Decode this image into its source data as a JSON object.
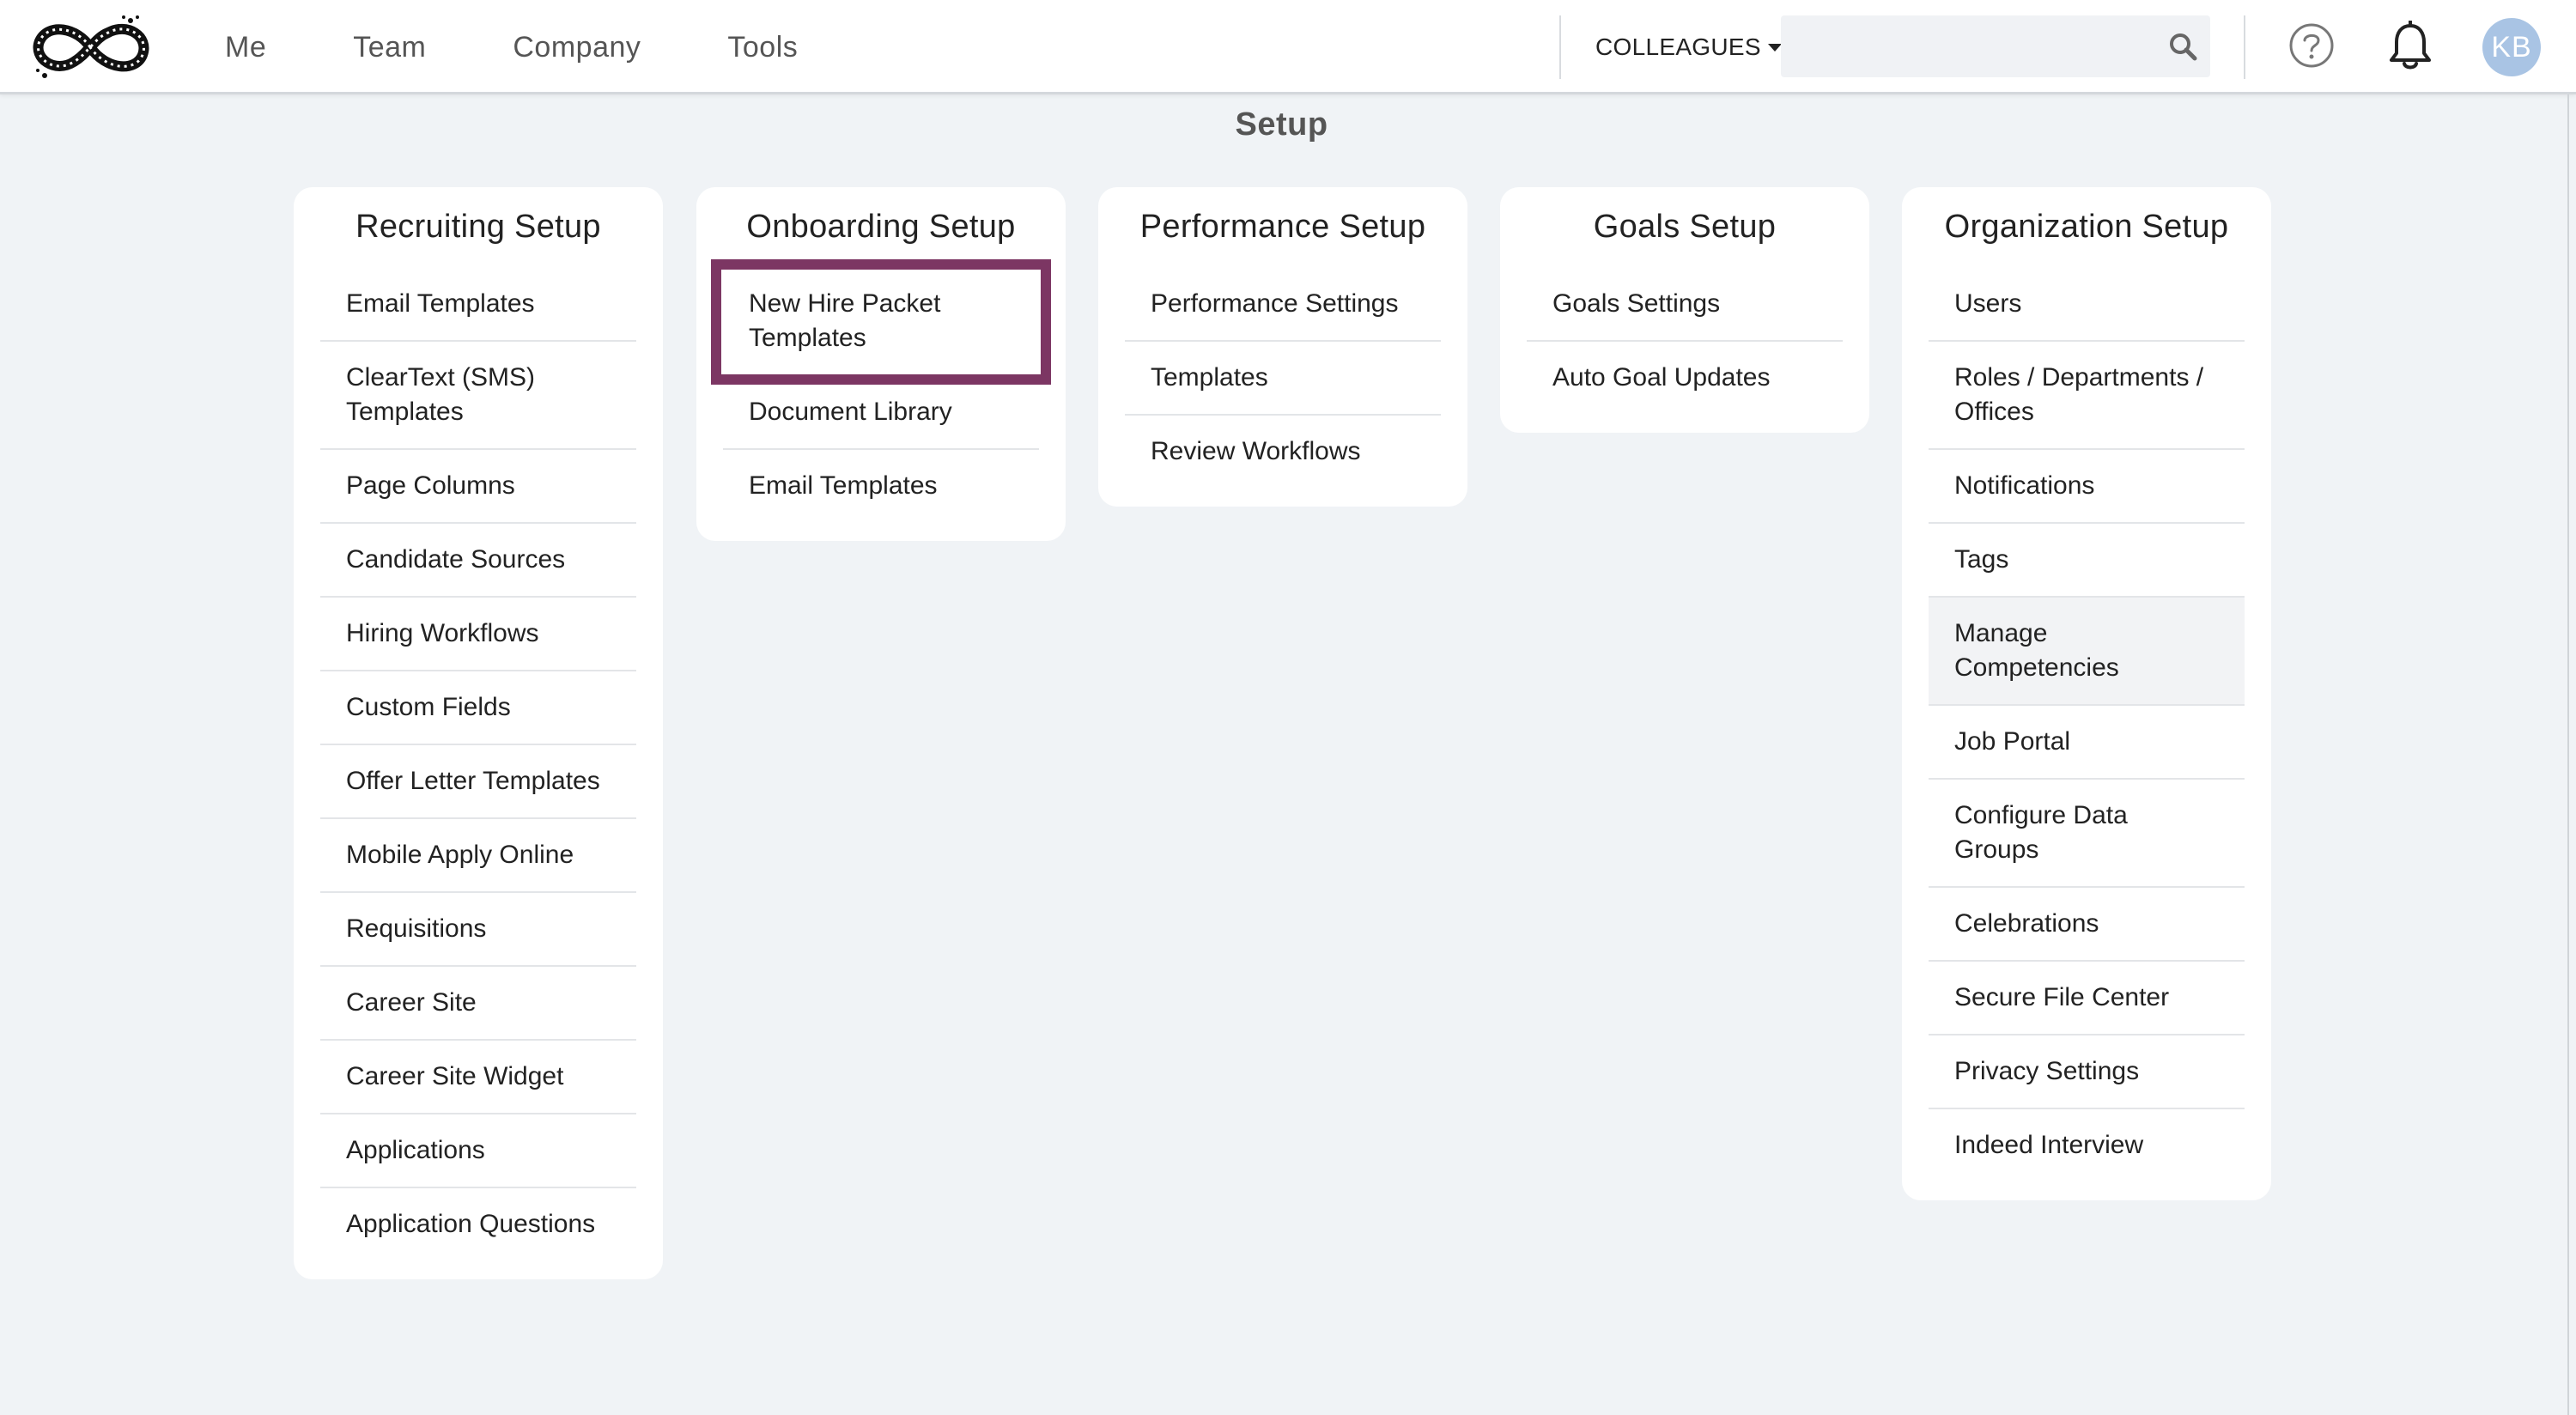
{
  "nav": {
    "items": [
      "Me",
      "Team",
      "Company",
      "Tools"
    ],
    "colleagues_label": "COLLEAGUES",
    "search_placeholder": "",
    "avatar_initials": "KB"
  },
  "page": {
    "title": "Setup"
  },
  "cards": [
    {
      "title": "Recruiting Setup",
      "items": [
        "Email Templates",
        "ClearText (SMS) Templates",
        "Page Columns",
        "Candidate Sources",
        "Hiring Workflows",
        "Custom Fields",
        "Offer Letter Templates",
        "Mobile Apply Online",
        "Requisitions",
        "Career Site",
        "Career Site Widget",
        "Applications",
        "Application Questions"
      ]
    },
    {
      "title": "Onboarding Setup",
      "items": [
        "New Hire Packet Templates",
        "Document Library",
        "Email Templates"
      ]
    },
    {
      "title": "Performance Setup",
      "items": [
        "Performance Settings",
        "Templates",
        "Review Workflows"
      ]
    },
    {
      "title": "Goals Setup",
      "items": [
        "Goals Settings",
        "Auto Goal Updates"
      ]
    },
    {
      "title": "Organization Setup",
      "items": [
        "Users",
        "Roles / Departments / Offices",
        "Notifications",
        "Tags",
        "Manage Competencies",
        "Job Portal",
        "Configure Data Groups",
        "Celebrations",
        "Secure File Center",
        "Privacy Settings",
        "Indeed Interview"
      ]
    }
  ],
  "colors": {
    "highlight": "#7c3663",
    "avatar_bg": "#a9c4e4",
    "page_bg": "#f0f3f6"
  },
  "icons": [
    "logo-infinity-icon",
    "search-icon",
    "help-icon",
    "bell-icon"
  ]
}
